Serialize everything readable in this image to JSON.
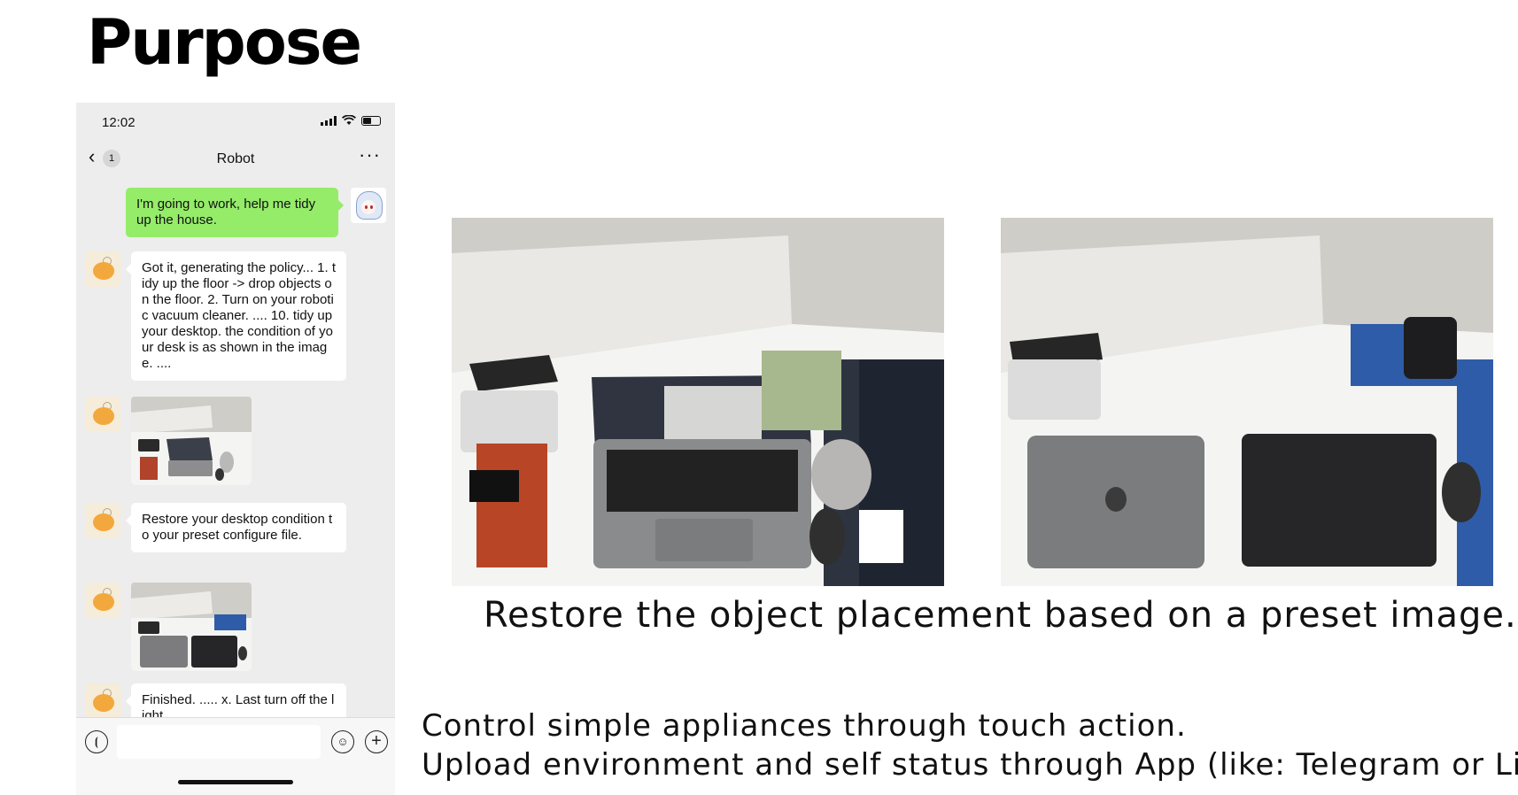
{
  "slide": {
    "title": "Purpose",
    "caption": "Restore the object placement based on a preset image.",
    "lines": [
      "Control simple appliances through touch action.",
      "Upload environment and self status through App (like: Telegram or Line)."
    ]
  },
  "phone": {
    "status_time": "12:02",
    "nav": {
      "back_badge": "1",
      "title": "Robot",
      "more": "···"
    },
    "messages": [
      {
        "side": "right",
        "text": "I'm going to work, help me tidy up the house."
      },
      {
        "side": "left",
        "text": "Got it, generating the policy... 1. tidy up the floor -> drop objects on the floor. 2. Turn on your robotic vacuum cleaner. .... 10. tidy up your desktop. the condition of your desk is as shown in the image. ...."
      },
      {
        "side": "left",
        "type": "image",
        "image": "current-desk-photo"
      },
      {
        "side": "left",
        "text": "Restore your desktop condition to your preset configure file."
      },
      {
        "side": "left",
        "type": "image",
        "image": "preset-desk-photo"
      },
      {
        "side": "left",
        "text": "Finished. ..... x. Last turn off the light"
      }
    ],
    "input": {
      "placeholder": ""
    }
  },
  "colors": {
    "sent_bubble": "#95ec69",
    "chat_background": "#ededed"
  }
}
